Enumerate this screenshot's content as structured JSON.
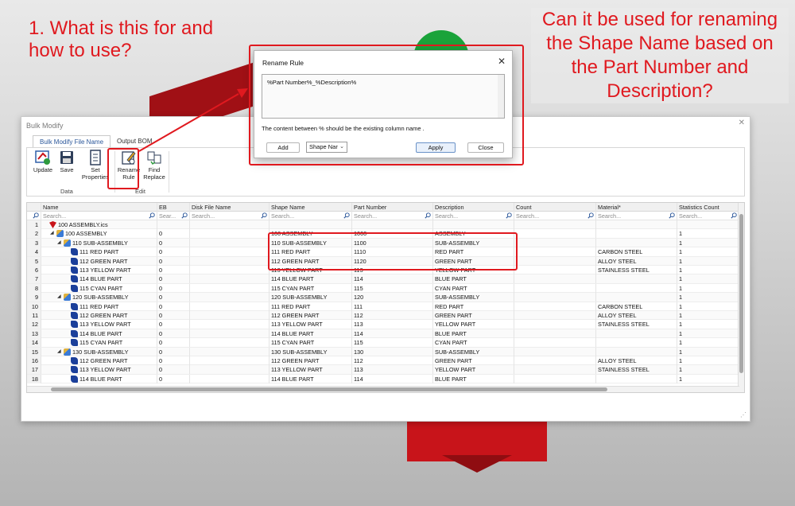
{
  "annotations": {
    "left_question": "1. What is this for and how to use?",
    "right_question": "Can it be used for renaming the Shape Name based on the Part Number and Description?"
  },
  "window": {
    "title": "Bulk Modify",
    "close_glyph": "✕",
    "tabs": [
      "Bulk Modify File Name",
      "Output BOM"
    ],
    "ribbon": {
      "buttons": [
        {
          "label": "Update",
          "icon": "update-icon"
        },
        {
          "label": "Save",
          "icon": "save-icon"
        },
        {
          "label": "Set Properties",
          "icon": "set-properties-icon"
        },
        {
          "label": "Rename Rule",
          "icon": "rename-rule-icon"
        },
        {
          "label": "Find Replace",
          "icon": "find-replace-icon"
        }
      ],
      "groups": [
        "Data",
        "Edit"
      ]
    }
  },
  "grid": {
    "columns": [
      "Name",
      "EB",
      "Disk File Name",
      "Shape Name",
      "Part Number",
      "Description",
      "Count",
      "Material*",
      "Statistics Count"
    ],
    "search_placeholders": [
      "Search...",
      "Sear...",
      "Search...",
      "Search...",
      "Search...",
      "Search...",
      "Search...",
      "Search...",
      "Search..."
    ],
    "rows": [
      {
        "n": "1",
        "name": "100 ASSEMBLY.ics",
        "icon": "file",
        "indent": 0,
        "tri": "",
        "eb": "",
        "shape": "",
        "pn": "",
        "desc": "",
        "mat": "",
        "stat": ""
      },
      {
        "n": "2",
        "name": "100 ASSEMBLY",
        "icon": "asm",
        "indent": 1,
        "tri": "◢",
        "eb": "0",
        "shape": "100 ASSEMBLY",
        "pn": "1000",
        "desc": "ASSEMBLY",
        "mat": "",
        "stat": "1"
      },
      {
        "n": "3",
        "name": "110 SUB-ASSEMBLY",
        "icon": "asm",
        "indent": 2,
        "tri": "◢",
        "eb": "0",
        "shape": "110 SUB-ASSEMBLY",
        "pn": "1100",
        "desc": "SUB-ASSEMBLY",
        "mat": "",
        "stat": "1"
      },
      {
        "n": "4",
        "name": "111 RED PART",
        "icon": "part",
        "indent": 3,
        "tri": "",
        "eb": "0",
        "shape": "111 RED PART",
        "pn": "1110",
        "desc": "RED PART",
        "mat": "CARBON STEEL",
        "stat": "1"
      },
      {
        "n": "5",
        "name": "112 GREEN PART",
        "icon": "part",
        "indent": 3,
        "tri": "",
        "eb": "0",
        "shape": "112 GREEN PART",
        "pn": "1120",
        "desc": "GREEN PART",
        "mat": "ALLOY STEEL",
        "stat": "1"
      },
      {
        "n": "6",
        "name": "113 YELLOW PART",
        "icon": "part",
        "indent": 3,
        "tri": "",
        "eb": "0",
        "shape": "113 YELLOW PART",
        "pn": "113",
        "desc": "YELLOW PART",
        "mat": "STAINLESS STEEL",
        "stat": "1"
      },
      {
        "n": "7",
        "name": "114 BLUE PART",
        "icon": "part",
        "indent": 3,
        "tri": "",
        "eb": "0",
        "shape": "114 BLUE PART",
        "pn": "114",
        "desc": "BLUE PART",
        "mat": "",
        "stat": "1"
      },
      {
        "n": "8",
        "name": "115 CYAN PART",
        "icon": "part",
        "indent": 3,
        "tri": "",
        "eb": "0",
        "shape": "115 CYAN PART",
        "pn": "115",
        "desc": "CYAN PART",
        "mat": "",
        "stat": "1"
      },
      {
        "n": "9",
        "name": "120 SUB-ASSEMBLY",
        "icon": "asm",
        "indent": 2,
        "tri": "◢",
        "eb": "0",
        "shape": "120 SUB-ASSEMBLY",
        "pn": "120",
        "desc": "SUB-ASSEMBLY",
        "mat": "",
        "stat": "1"
      },
      {
        "n": "10",
        "name": "111 RED PART",
        "icon": "part",
        "indent": 3,
        "tri": "",
        "eb": "0",
        "shape": "111 RED PART",
        "pn": "111",
        "desc": "RED PART",
        "mat": "CARBON STEEL",
        "stat": "1"
      },
      {
        "n": "11",
        "name": "112 GREEN PART",
        "icon": "part",
        "indent": 3,
        "tri": "",
        "eb": "0",
        "shape": "112 GREEN PART",
        "pn": "112",
        "desc": "GREEN PART",
        "mat": "ALLOY STEEL",
        "stat": "1"
      },
      {
        "n": "12",
        "name": "113 YELLOW PART",
        "icon": "part",
        "indent": 3,
        "tri": "",
        "eb": "0",
        "shape": "113 YELLOW PART",
        "pn": "113",
        "desc": "YELLOW PART",
        "mat": "STAINLESS STEEL",
        "stat": "1"
      },
      {
        "n": "13",
        "name": "114 BLUE PART",
        "icon": "part",
        "indent": 3,
        "tri": "",
        "eb": "0",
        "shape": "114 BLUE PART",
        "pn": "114",
        "desc": "BLUE PART",
        "mat": "",
        "stat": "1"
      },
      {
        "n": "14",
        "name": "115 CYAN PART",
        "icon": "part",
        "indent": 3,
        "tri": "",
        "eb": "0",
        "shape": "115 CYAN PART",
        "pn": "115",
        "desc": "CYAN PART",
        "mat": "",
        "stat": "1"
      },
      {
        "n": "15",
        "name": "130 SUB-ASSEMBLY",
        "icon": "asm",
        "indent": 2,
        "tri": "◢",
        "eb": "0",
        "shape": "130 SUB-ASSEMBLY",
        "pn": "130",
        "desc": "SUB-ASSEMBLY",
        "mat": "",
        "stat": "1"
      },
      {
        "n": "16",
        "name": "112 GREEN PART",
        "icon": "part",
        "indent": 3,
        "tri": "",
        "eb": "0",
        "shape": "112 GREEN PART",
        "pn": "112",
        "desc": "GREEN PART",
        "mat": "ALLOY STEEL",
        "stat": "1"
      },
      {
        "n": "17",
        "name": "113 YELLOW PART",
        "icon": "part",
        "indent": 3,
        "tri": "",
        "eb": "0",
        "shape": "113 YELLOW PART",
        "pn": "113",
        "desc": "YELLOW PART",
        "mat": "STAINLESS STEEL",
        "stat": "1"
      },
      {
        "n": "18",
        "name": "114 BLUE PART",
        "icon": "part",
        "indent": 3,
        "tri": "",
        "eb": "0",
        "shape": "114 BLUE PART",
        "pn": "114",
        "desc": "BLUE PART",
        "mat": "",
        "stat": "1"
      }
    ]
  },
  "dialog": {
    "title": "Rename Rule",
    "close_glyph": "✕",
    "rule_text": "%Part Number%_%Description%",
    "note": "The content between % should be the existing column name .",
    "add_label": "Add",
    "select_value": "Shape Nar",
    "apply_label": "Apply",
    "close_label": "Close"
  },
  "colors": {
    "annotation_red": "#e0191f",
    "tab_blue": "#2b579a"
  }
}
